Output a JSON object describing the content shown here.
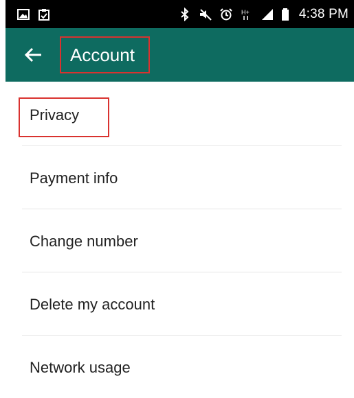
{
  "status_bar": {
    "time": "4:38 PM",
    "left_icons": [
      "image-icon",
      "clipboard-icon"
    ],
    "right_icons": [
      "bluetooth-icon",
      "mute-icon",
      "alarm-icon",
      "h-plus-signal-icon",
      "signal-icon",
      "battery-icon"
    ]
  },
  "app_bar": {
    "title": "Account",
    "back_icon": "arrow-left-icon",
    "color": "#0e6b60"
  },
  "menu": {
    "items": [
      {
        "label": "Privacy"
      },
      {
        "label": "Payment info"
      },
      {
        "label": "Change number"
      },
      {
        "label": "Delete my account"
      },
      {
        "label": "Network usage"
      }
    ]
  },
  "highlight_color": "#d9322f"
}
